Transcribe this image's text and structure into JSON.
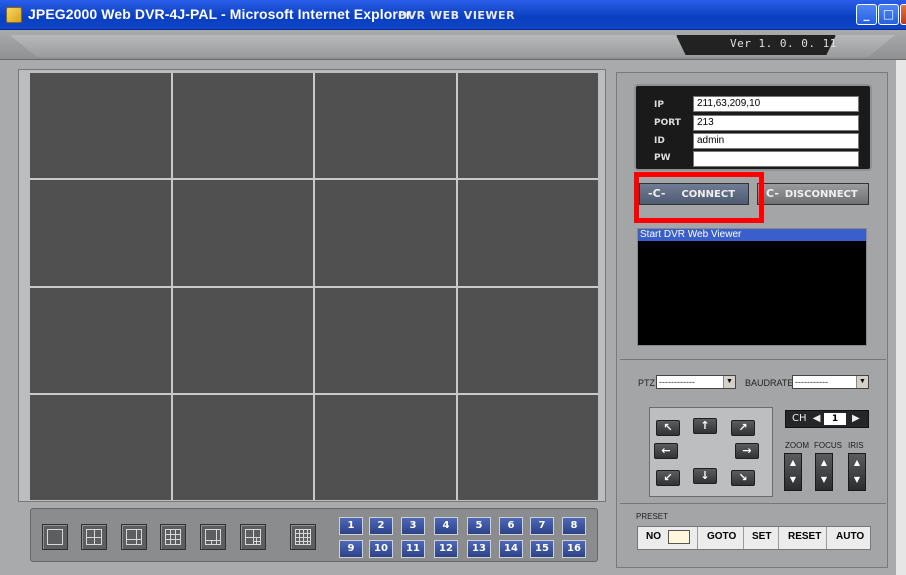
{
  "window": {
    "title": "JPEG2000 Web DVR-4J-PAL - Microsoft Internet Explorer",
    "min_glyph": "_",
    "max_glyph": "□",
    "close_glyph": "X"
  },
  "header": {
    "title": "DVR WEB VIEWER",
    "version": "Ver 1. 0. 0. 11"
  },
  "login": {
    "ip_label": "IP",
    "ip_value": "211,63,209,10",
    "port_label": "PORT",
    "port_value": "213",
    "id_label": "ID",
    "id_value": "admin",
    "pw_label": "PW",
    "pw_value": ""
  },
  "connection": {
    "connect_label": "CONNECT",
    "disconnect_label": "DISCONNECT",
    "connect_icon": "-C-",
    "disconnect_icon": "C-"
  },
  "log": {
    "lines": [
      "Start DVR Web Viewer"
    ]
  },
  "ptz": {
    "ptz_label": "PTZ",
    "ptz_value": "------------",
    "baud_label": "BAUDRATES",
    "baud_value": "-----------",
    "ch_label": "CH",
    "ch_value": "1",
    "zoom_label": "ZOOM",
    "focus_label": "FOCUS",
    "iris_label": "IRIS",
    "arrows": {
      "up_left": "↖",
      "up": "↑",
      "up_right": "↗",
      "left": "←",
      "right": "→",
      "down_left": "↙",
      "down": "↓",
      "down_right": "↘"
    },
    "lens_up": "▲",
    "lens_down": "▼",
    "ch_prev": "◀",
    "ch_next": "▶"
  },
  "preset": {
    "label": "PRESET",
    "no_label": "NO",
    "goto_label": "GOTO",
    "set_label": "SET",
    "reset_label": "RESET",
    "auto_label": "AUTO"
  },
  "channels": {
    "row1": [
      "1",
      "2",
      "3",
      "4",
      "5",
      "6",
      "7",
      "8"
    ],
    "row2": [
      "9",
      "10",
      "11",
      "12",
      "13",
      "14",
      "15",
      "16"
    ]
  },
  "layout_buttons": [
    "split-1-icon",
    "split-4-icon",
    "split-6-icon",
    "split-9-icon",
    "split-8-icon",
    "split-10-icon",
    "split-16-icon"
  ],
  "colors": {
    "highlight": "#ff0000",
    "video_cell": "#505050",
    "channel_button": "#2c4288"
  }
}
